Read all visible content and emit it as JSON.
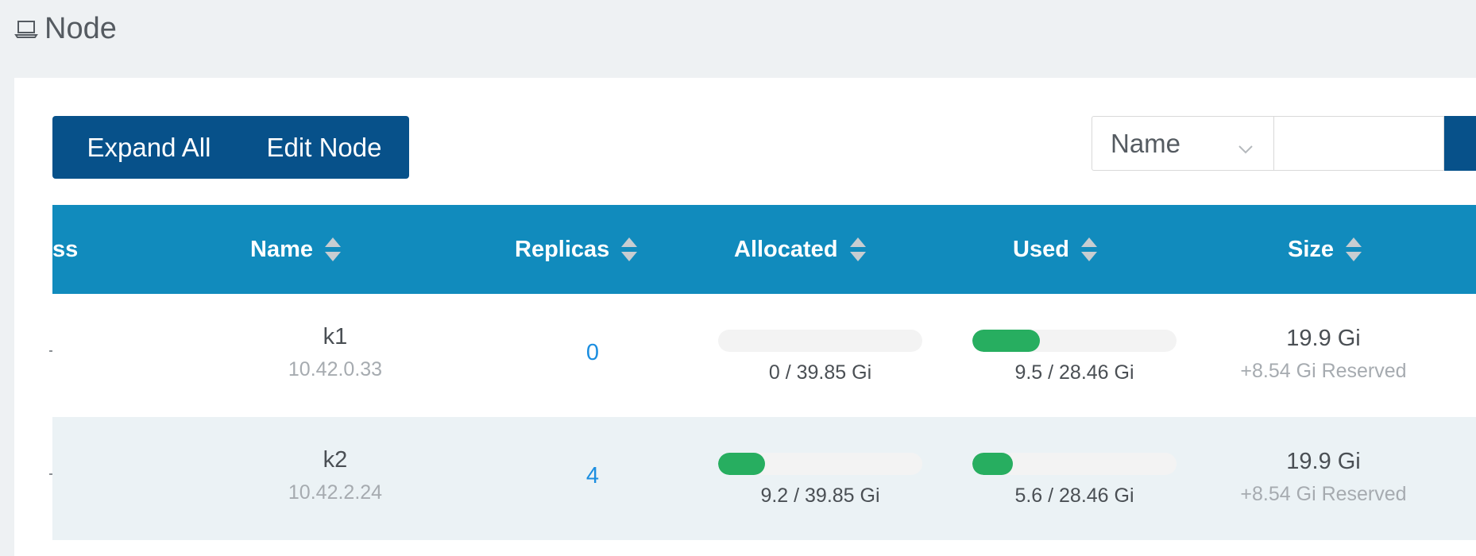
{
  "page": {
    "title": "Node"
  },
  "toolbar": {
    "expand_all_label": "Expand All",
    "edit_node_label": "Edit Node"
  },
  "search": {
    "field_selected": "Name",
    "value": ""
  },
  "table": {
    "columns": {
      "address": "ss",
      "name": "Name",
      "replicas": "Replicas",
      "allocated": "Allocated",
      "used": "Used",
      "size": "Size"
    },
    "rows": [
      {
        "name": "k1",
        "ip": "10.42.0.33",
        "replicas": "0",
        "allocated_label": "0 / 39.85 Gi",
        "allocated_percent": 0,
        "used_label": "9.5 / 28.46 Gi",
        "used_percent": 33,
        "size": "19.9 Gi",
        "reserved": "+8.54 Gi Reserved"
      },
      {
        "name": "k2",
        "ip": "10.42.2.24",
        "replicas": "4",
        "allocated_label": "9.2 / 39.85 Gi",
        "allocated_percent": 23,
        "used_label": "5.6 / 28.46 Gi",
        "used_percent": 20,
        "size": "19.9 Gi",
        "reserved": "+8.54 Gi Reserved"
      }
    ]
  },
  "colors": {
    "primary_button": "#07518a",
    "table_header": "#118bbd",
    "progress_fill": "#27ae60",
    "link": "#1b8ee0"
  }
}
